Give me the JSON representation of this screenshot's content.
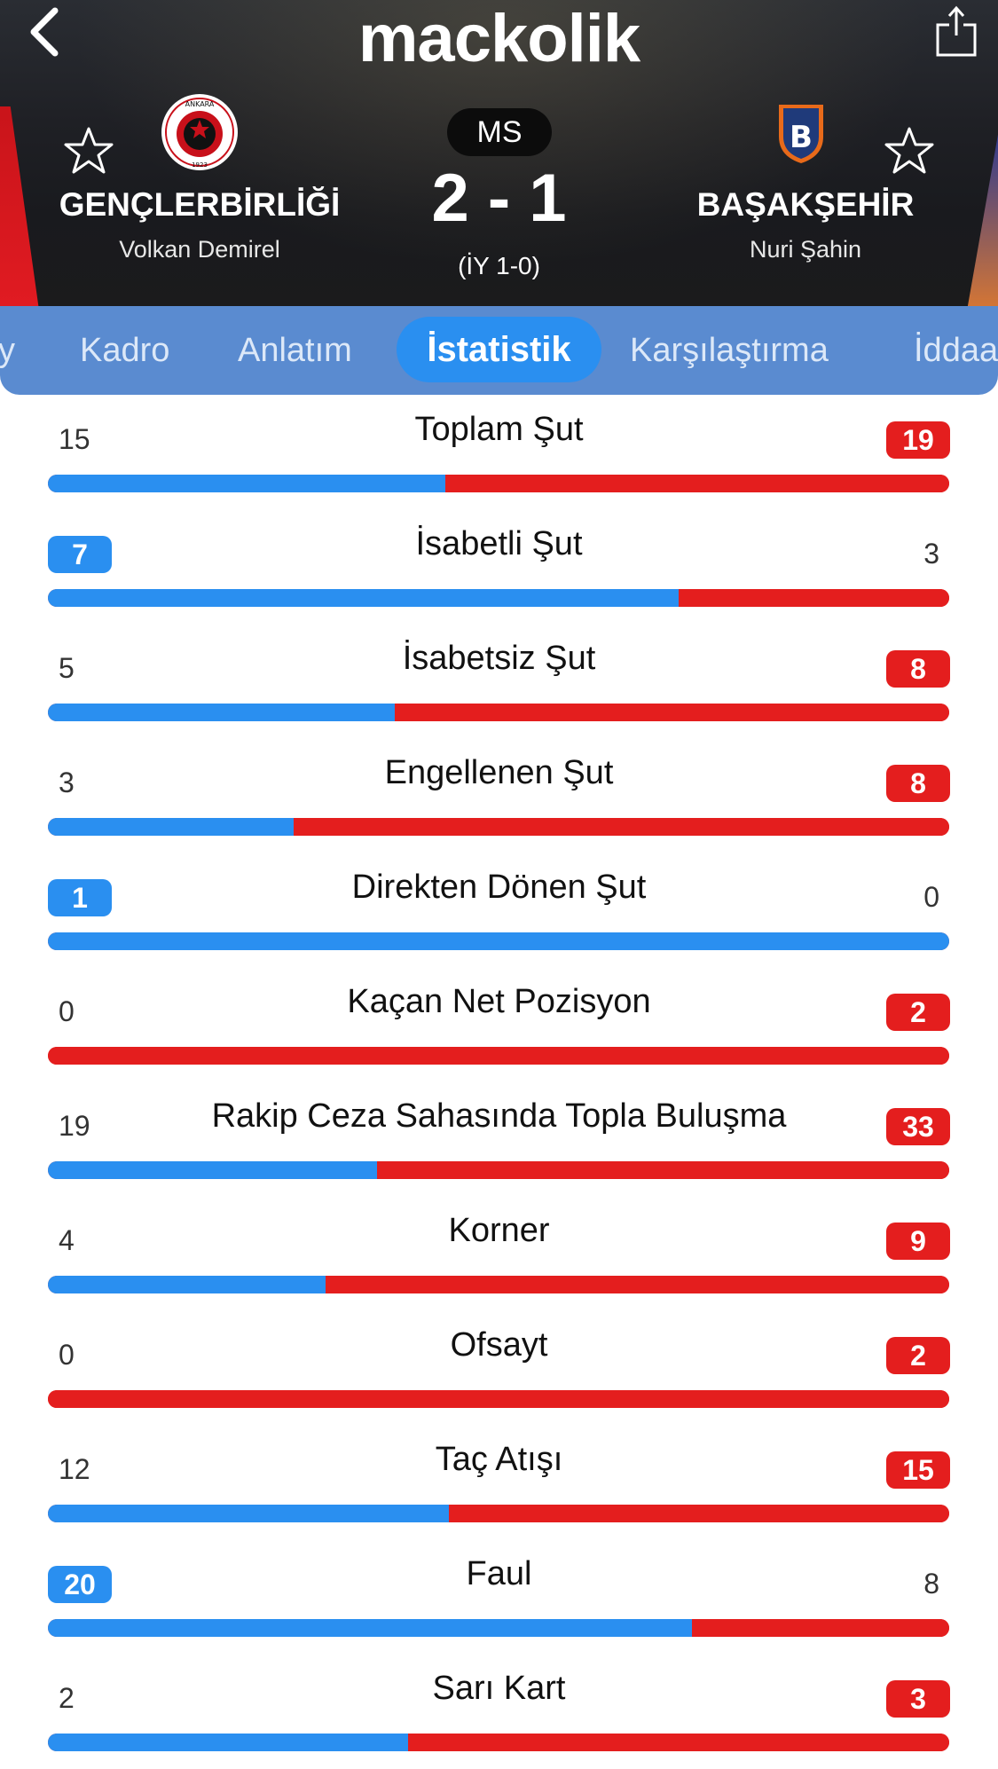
{
  "app": {
    "title": "mackolik"
  },
  "match": {
    "status": "MS",
    "score": "2 - 1",
    "halftime": "(İY 1-0)",
    "home": {
      "name": "GENÇLERBİRLİĞİ",
      "coach": "Volkan Demirel",
      "crest_text": "ANKARA",
      "crest_year": "1923"
    },
    "away": {
      "name": "BAŞAKŞEHİR",
      "coach": "Nuri Şahin",
      "crest_letter": "B"
    }
  },
  "tabs": [
    {
      "label": "y"
    },
    {
      "label": "Kadro"
    },
    {
      "label": "Anlatım"
    },
    {
      "label": "İstatistik",
      "active": true
    },
    {
      "label": "Karşılaştırma"
    },
    {
      "label": "İddaa"
    }
  ],
  "colors": {
    "home": "#2a8ff0",
    "away": "#e41e1e",
    "tabbar": "#5a8bd0"
  },
  "stats": [
    {
      "label": "Toplam Şut",
      "home": 15,
      "away": 19
    },
    {
      "label": "İsabetli Şut",
      "home": 7,
      "away": 3
    },
    {
      "label": "İsabetsiz Şut",
      "home": 5,
      "away": 8
    },
    {
      "label": "Engellenen Şut",
      "home": 3,
      "away": 8
    },
    {
      "label": "Direkten Dönen Şut",
      "home": 1,
      "away": 0
    },
    {
      "label": "Kaçan Net Pozisyon",
      "home": 0,
      "away": 2
    },
    {
      "label": "Rakip Ceza Sahasında Topla Buluşma",
      "home": 19,
      "away": 33
    },
    {
      "label": "Korner",
      "home": 4,
      "away": 9
    },
    {
      "label": "Ofsayt",
      "home": 0,
      "away": 2
    },
    {
      "label": "Taç Atışı",
      "home": 12,
      "away": 15
    },
    {
      "label": "Faul",
      "home": 20,
      "away": 8
    },
    {
      "label": "Sarı Kart",
      "home": 2,
      "away": 3
    }
  ]
}
